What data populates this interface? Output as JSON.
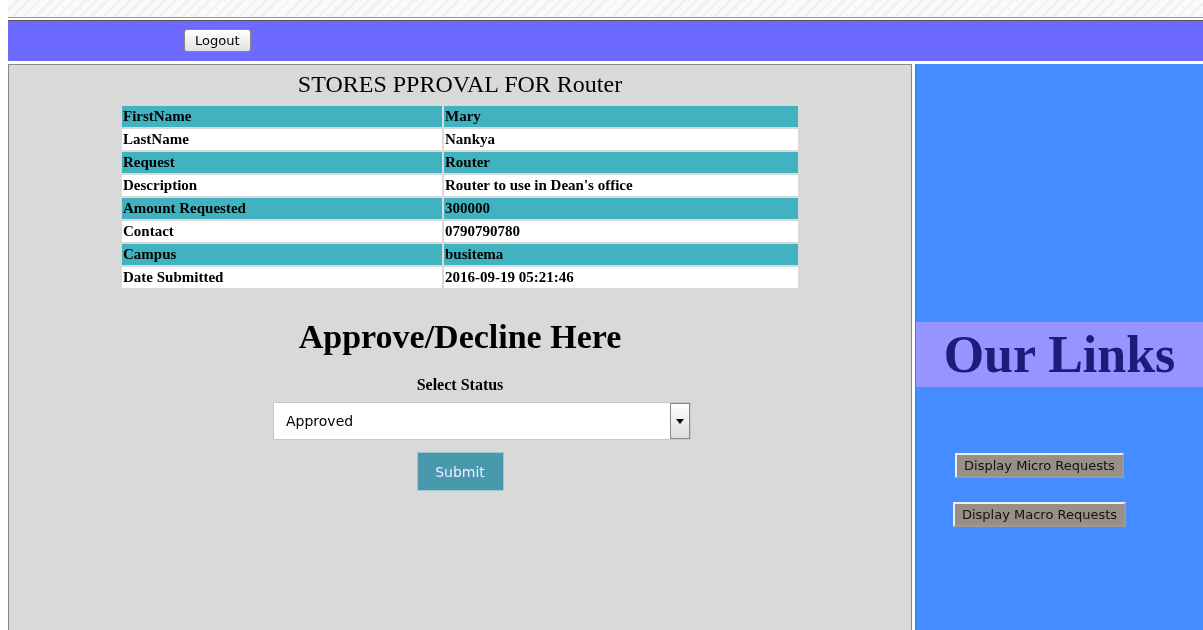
{
  "header": {
    "logout_button": "Logout"
  },
  "main": {
    "title": "STORES PPROVAL FOR Router",
    "details": [
      {
        "label": "FirstName",
        "value": "Mary"
      },
      {
        "label": "LastName",
        "value": "Nankya"
      },
      {
        "label": "Request",
        "value": "Router"
      },
      {
        "label": "Description",
        "value": "Router to use in Dean's office"
      },
      {
        "label": "Amount Requested",
        "value": "300000"
      },
      {
        "label": "Contact",
        "value": "0790790780"
      },
      {
        "label": "Campus",
        "value": "busitema"
      },
      {
        "label": "Date Submitted",
        "value": "2016-09-19 05:21:46"
      }
    ],
    "heading": "Approve/Decline Here",
    "status_label": "Select Status",
    "status_value": "Approved",
    "submit_button": "Submit"
  },
  "sidebar": {
    "title": "Our Links",
    "buttons": [
      "Display Micro Requests",
      "Display Macro Requests"
    ]
  }
}
